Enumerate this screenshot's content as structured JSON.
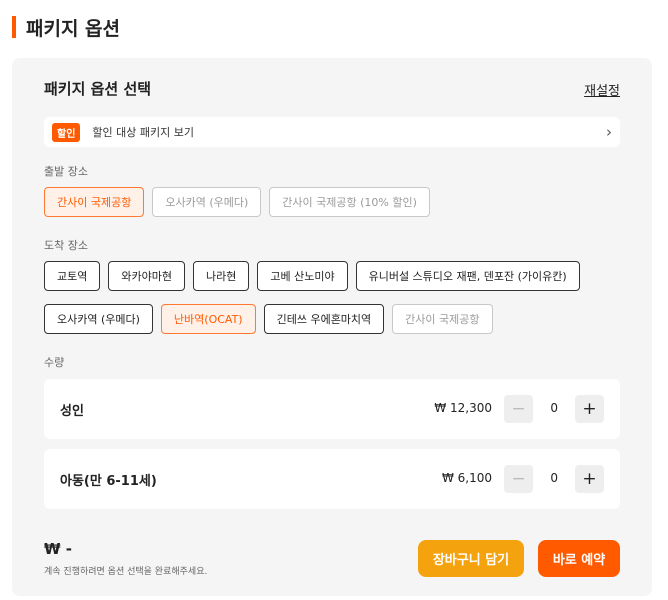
{
  "section": {
    "title": "패키지 옵션"
  },
  "card": {
    "title": "패키지 옵션 선택",
    "reset_label": "재설정",
    "discount": {
      "badge": "할인",
      "text": "할인 대상 패키지 보기",
      "chevron": "›"
    },
    "departure": {
      "label": "출발 장소",
      "options": [
        {
          "label": "간사이 국제공항",
          "state": "selected"
        },
        {
          "label": "오사카역 (우메다)",
          "state": "disabled"
        },
        {
          "label": "간사이 국제공항 (10% 할인)",
          "state": "disabled"
        }
      ]
    },
    "arrival": {
      "label": "도착 장소",
      "row1": [
        {
          "label": "교토역",
          "state": "normal"
        },
        {
          "label": "와카야마현",
          "state": "normal"
        },
        {
          "label": "나라현",
          "state": "normal"
        },
        {
          "label": "고베 산노미야",
          "state": "normal"
        },
        {
          "label": "유니버설 스튜디오 재팬, 덴포잔 (가이유칸)",
          "state": "normal"
        }
      ],
      "row2": [
        {
          "label": "오사카역 (우메다)",
          "state": "normal"
        },
        {
          "label": "난바역(OCAT)",
          "state": "selected"
        },
        {
          "label": "긴테쓰 우에혼마치역",
          "state": "normal"
        },
        {
          "label": "간사이 국제공항",
          "state": "disabled"
        }
      ]
    },
    "quantity": {
      "label": "수량",
      "rows": [
        {
          "label": "성인",
          "price": "₩ 12,300",
          "value": "0",
          "minus": "−",
          "plus": "+"
        },
        {
          "label": "아동(만 6-11세)",
          "price": "₩ 6,100",
          "value": "0",
          "minus": "−",
          "plus": "+"
        }
      ]
    },
    "total": {
      "amount": "₩ -",
      "note": "계속 진행하려면 옵션 선택을 완료해주세요."
    },
    "buttons": {
      "cart": "장바구니 담기",
      "book": "바로 예약"
    }
  },
  "colors": {
    "accent": "#ff5a00",
    "cart": "#f5a20f",
    "card_bg": "#f5f5f5"
  }
}
